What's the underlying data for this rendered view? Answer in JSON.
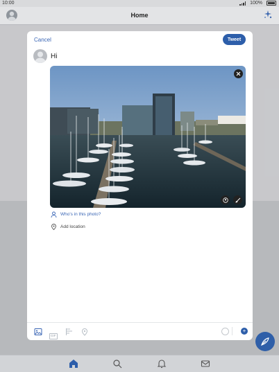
{
  "status": {
    "time": "10:00",
    "battery": "100%"
  },
  "app": {
    "title": "Home"
  },
  "compose": {
    "cancel_label": "Cancel",
    "tweet_label": "Tweet",
    "text": "Hi",
    "who_in_photo": "Who's in this photo?",
    "add_location": "Add location",
    "gif_label": "GIF"
  },
  "colors": {
    "accent": "#2d5eaa",
    "link": "#3a66b5"
  }
}
